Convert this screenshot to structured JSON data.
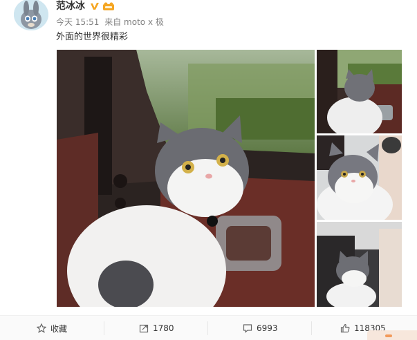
{
  "post": {
    "username": "范冰冰",
    "meta": {
      "time": "今天 15:51",
      "source": "来自 moto x 极"
    },
    "text": "外面的世界很精彩"
  },
  "actions": {
    "favorite": "收藏",
    "repost": "1780",
    "comment": "6993",
    "like": "118305"
  },
  "icons": [
    "avatar-image",
    "verified-icon",
    "vip-icon",
    "star-icon",
    "repost-icon",
    "comment-icon",
    "thumb-up-icon"
  ],
  "colors": {
    "verified": "#f5a623",
    "meta": "#808080"
  }
}
